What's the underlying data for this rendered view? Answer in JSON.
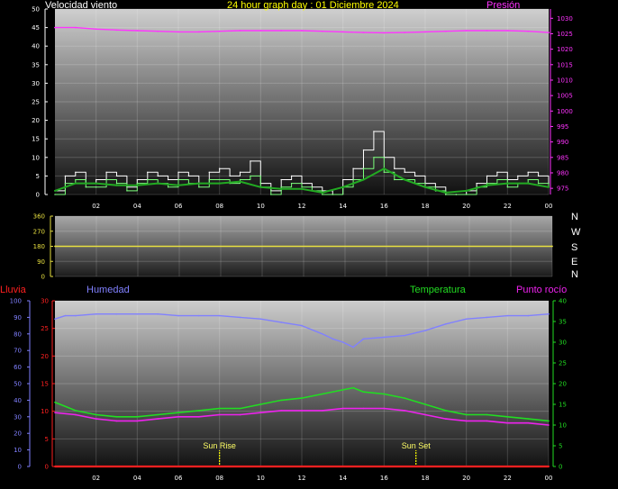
{
  "header": {
    "wind_label": "Velocidad viento",
    "title": "24 hour graph day : 01 Diciembre 2024",
    "pressure_label": "Presión"
  },
  "compass": [
    "N",
    "W",
    "S",
    "E",
    "N"
  ],
  "labels": {
    "rain": "Lluvia",
    "humidity": "Humedad",
    "temperature": "Temperatura",
    "dewpoint": "Punto rocío",
    "sunrise": "Sun Rise",
    "sunset": "Sun Set"
  },
  "colors": {
    "wind_text": "#ffffff",
    "title_text": "#ffff00",
    "pressure": "#ff33ff",
    "rain": "#ff2020",
    "humidity": "#8080ff",
    "temperature": "#22dd22",
    "dewpoint": "#ee22ee",
    "direction": "#e8e040"
  },
  "chart_data": [
    {
      "type": "line",
      "name": "wind-pressure",
      "x_ticks": [
        "02",
        "04",
        "06",
        "08",
        "10",
        "12",
        "14",
        "16",
        "18",
        "20",
        "22",
        "00"
      ],
      "left_axis": {
        "label": "Velocidad viento",
        "ticks": [
          0,
          5,
          10,
          15,
          20,
          25,
          30,
          35,
          40,
          45,
          50
        ],
        "range": [
          0,
          50
        ]
      },
      "right_axis": {
        "label": "Presión",
        "ticks": [
          975,
          980,
          985,
          990,
          995,
          1000,
          1005,
          1010,
          1015,
          1020,
          1025,
          1030
        ],
        "range": [
          973,
          1033
        ]
      },
      "series": [
        {
          "name": "Presión",
          "axis": "right",
          "x": [
            0,
            1,
            2,
            3,
            4,
            5,
            6,
            7,
            8,
            9,
            10,
            11,
            12,
            13,
            14,
            15,
            16,
            17,
            18,
            19,
            20,
            21,
            22,
            23,
            24
          ],
          "y": [
            1027,
            1027,
            1026.5,
            1026.2,
            1026,
            1025.8,
            1025.6,
            1025.6,
            1025.8,
            1026,
            1026,
            1026,
            1026,
            1025.8,
            1025.6,
            1025.4,
            1025.3,
            1025.4,
            1025.6,
            1025.8,
            1026,
            1026,
            1026,
            1025.8,
            1025.4
          ]
        },
        {
          "name": "gust",
          "axis": "left",
          "x": [
            0,
            0.5,
            1,
            1.5,
            2,
            2.5,
            3,
            3.5,
            4,
            4.5,
            5,
            5.5,
            6,
            6.5,
            7,
            7.5,
            8,
            8.5,
            9,
            9.5,
            10,
            10.5,
            11,
            11.5,
            12,
            12.5,
            13,
            13.5,
            14,
            14.5,
            15,
            15.5,
            16,
            16.5,
            17,
            17.5,
            18,
            18.5,
            19,
            19.5,
            20,
            20.5,
            21,
            21.5,
            22,
            22.5,
            23,
            23.5,
            24
          ],
          "y": [
            1,
            5,
            6,
            3,
            4,
            6,
            5,
            2,
            4,
            6,
            5,
            4,
            6,
            5,
            3,
            6,
            7,
            5,
            6,
            9,
            3,
            1,
            4,
            5,
            3,
            2,
            1,
            0,
            4,
            7,
            12,
            17,
            10,
            7,
            6,
            5,
            3,
            2,
            0,
            0,
            1,
            3,
            5,
            6,
            4,
            5,
            6,
            5,
            3
          ]
        },
        {
          "name": "speed",
          "axis": "left",
          "x": [
            0,
            0.5,
            1,
            1.5,
            2,
            2.5,
            3,
            3.5,
            4,
            4.5,
            5,
            5.5,
            6,
            6.5,
            7,
            7.5,
            8,
            8.5,
            9,
            9.5,
            10,
            10.5,
            11,
            11.5,
            12,
            12.5,
            13,
            13.5,
            14,
            14.5,
            15,
            15.5,
            16,
            16.5,
            17,
            17.5,
            18,
            18.5,
            19,
            19.5,
            20,
            20.5,
            21,
            21.5,
            22,
            22.5,
            23,
            23.5,
            24
          ],
          "y": [
            0,
            3,
            4,
            2,
            2,
            4,
            3,
            1,
            3,
            4,
            3,
            2,
            4,
            3,
            2,
            4,
            4,
            3,
            4,
            5,
            2,
            0,
            2,
            3,
            2,
            1,
            0,
            0,
            2,
            4,
            7,
            10,
            6,
            4,
            4,
            3,
            2,
            1,
            0,
            0,
            0,
            2,
            3,
            4,
            2,
            3,
            4,
            3,
            2
          ]
        },
        {
          "name": "avg",
          "axis": "left",
          "x": [
            0,
            1,
            2,
            3,
            4,
            5,
            6,
            7,
            8,
            9,
            10,
            11,
            12,
            13,
            14,
            15,
            16,
            17,
            18,
            19,
            20,
            21,
            22,
            23,
            24
          ],
          "y": [
            1,
            3,
            3,
            2.5,
            2.5,
            3,
            2.5,
            3,
            3,
            3.5,
            2,
            1.5,
            1.5,
            0.5,
            2,
            4,
            7,
            4,
            2,
            0.5,
            1,
            2.5,
            3,
            3,
            2
          ]
        }
      ]
    },
    {
      "type": "line",
      "name": "wind-direction",
      "left_axis": {
        "ticks": [
          0,
          90,
          180,
          270,
          360
        ],
        "range": [
          0,
          360
        ]
      },
      "series": [
        {
          "name": "direction",
          "x": [
            0,
            24
          ],
          "y": [
            180,
            180
          ]
        }
      ]
    },
    {
      "type": "line",
      "name": "climate",
      "x_ticks": [
        "02",
        "04",
        "06",
        "08",
        "10",
        "12",
        "14",
        "16",
        "18",
        "20",
        "22",
        "00"
      ],
      "left_axis_outer": {
        "label": "Lluvia",
        "ticks": [
          0,
          10,
          20,
          30,
          40,
          50,
          60,
          70,
          80,
          90,
          100
        ],
        "range": [
          0,
          100
        ]
      },
      "left_axis_inner": {
        "ticks": [
          0,
          5,
          10,
          15,
          20,
          25,
          30
        ],
        "range": [
          0,
          30
        ]
      },
      "right_axis": {
        "ticks": [
          0,
          5,
          10,
          15,
          20,
          25,
          30,
          35,
          40
        ],
        "range": [
          0,
          40
        ]
      },
      "markers": [
        {
          "label": "Sun Rise",
          "x": 8.0
        },
        {
          "label": "Sun Set",
          "x": 17.55
        }
      ],
      "series": [
        {
          "name": "Humedad",
          "axis": "left_outer",
          "x": [
            0,
            0.5,
            1,
            2,
            3,
            4,
            5,
            6,
            7,
            8,
            9,
            10,
            11,
            12,
            13,
            13.5,
            14,
            14.5,
            15,
            16,
            17,
            18,
            19,
            20,
            21,
            22,
            23,
            24
          ],
          "y": [
            89,
            91,
            91,
            92,
            92,
            92,
            92,
            91,
            91,
            91,
            90,
            89,
            87,
            85,
            80,
            77,
            75,
            72,
            77,
            78,
            79,
            82,
            86,
            89,
            90,
            91,
            91,
            92
          ]
        },
        {
          "name": "Temperatura",
          "axis": "right",
          "x": [
            0,
            0.5,
            1,
            2,
            3,
            4,
            5,
            6,
            7,
            8,
            9,
            10,
            11,
            12,
            13,
            14,
            14.5,
            15,
            16,
            17,
            18,
            19,
            20,
            21,
            22,
            23,
            24
          ],
          "y": [
            15.5,
            14.5,
            13.5,
            12.5,
            12,
            12,
            12.5,
            13,
            13.5,
            14,
            14,
            15,
            16,
            16.5,
            17.5,
            18.5,
            19,
            18,
            17.5,
            16.5,
            15,
            13.5,
            12.5,
            12.5,
            12,
            11.5,
            11
          ]
        },
        {
          "name": "Punto rocío",
          "axis": "right",
          "x": [
            0,
            1,
            2,
            3,
            4,
            5,
            6,
            7,
            8,
            9,
            10,
            11,
            12,
            13,
            14,
            15,
            16,
            17,
            18,
            19,
            20,
            21,
            22,
            23,
            24
          ],
          "y": [
            13,
            12.5,
            11.5,
            11,
            11,
            11.5,
            12,
            12,
            12.5,
            12.5,
            13,
            13.5,
            13.5,
            13.5,
            14,
            14,
            14,
            13.5,
            12.5,
            11.5,
            11,
            11,
            10.5,
            10.5,
            10
          ]
        },
        {
          "name": "Lluvia",
          "axis": "left_inner",
          "x": [
            0,
            24
          ],
          "y": [
            0,
            0
          ]
        }
      ]
    }
  ]
}
